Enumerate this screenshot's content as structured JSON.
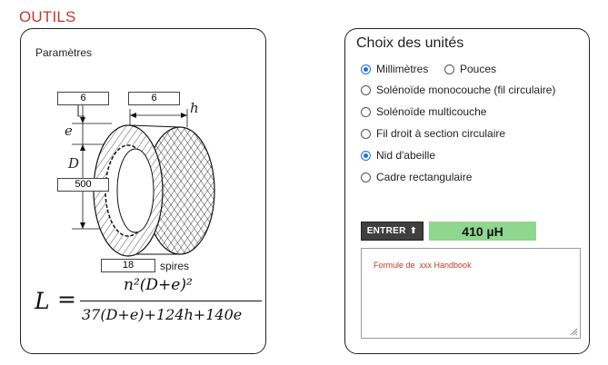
{
  "app": {
    "title": "OUTILS"
  },
  "params": {
    "title": "Paramètres",
    "e_value": "6",
    "h_value": "6",
    "D_value": "500",
    "turns_value": "18",
    "turns_unit": "spires",
    "labels": {
      "e": "e",
      "h": "h",
      "D": "D"
    }
  },
  "formula": {
    "lhs": "L",
    "eq": "=",
    "numerator": "n²(D+e)²",
    "denominator": "37(D+e)+124h+140e"
  },
  "units": {
    "title": "Choix des unités",
    "options": [
      {
        "label": "Millimètres",
        "checked": true
      },
      {
        "label": "Pouces",
        "checked": false
      }
    ]
  },
  "coil_types": [
    {
      "label": "Solénoïde monocouche (fil circulaire)",
      "checked": false
    },
    {
      "label": "Solénoïde multicouche",
      "checked": false
    },
    {
      "label": "Fil droit à section circulaire",
      "checked": false
    },
    {
      "label": "Nid d'abeille",
      "checked": true
    },
    {
      "label": "Cadre rectangulaire",
      "checked": false
    }
  ],
  "actions": {
    "enter_label": "ENTRER",
    "enter_icon": "arrow-up-icon"
  },
  "result": {
    "value": "410 µH",
    "color": "#8fd68f"
  },
  "notes": {
    "text": "Formule de  xxx Handbook",
    "text_color": "#c0392b"
  },
  "colors": {
    "accent": "#c0392b",
    "radio": "#1a73e8",
    "button": "#3f3f3f"
  }
}
